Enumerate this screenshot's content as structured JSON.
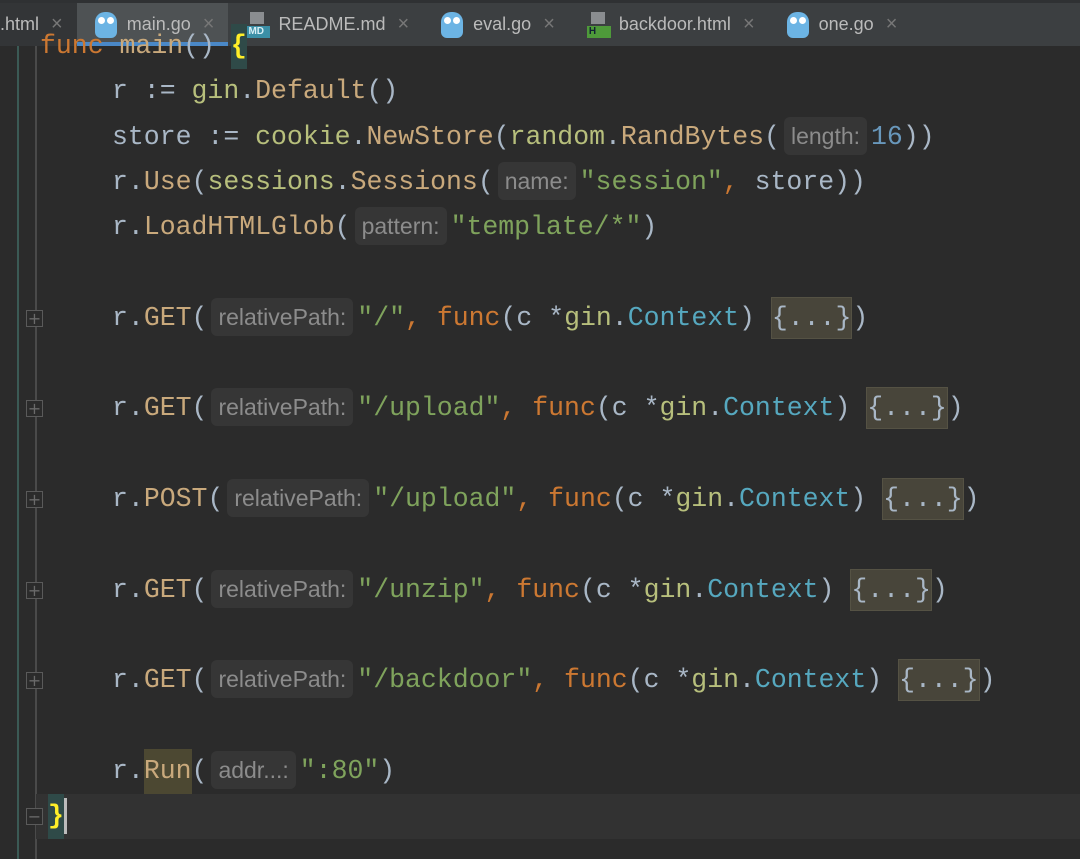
{
  "tabs": [
    {
      "label": ".html",
      "icon": "html-file-icon",
      "active": false
    },
    {
      "label": "main.go",
      "icon": "gopher-icon",
      "active": true
    },
    {
      "label": "README.md",
      "icon": "markdown-file-icon",
      "active": false
    },
    {
      "label": "eval.go",
      "icon": "gopher-icon",
      "active": false
    },
    {
      "label": "backdoor.html",
      "icon": "html-file-icon",
      "active": false
    },
    {
      "label": "one.go",
      "icon": "gopher-icon",
      "active": false
    }
  ],
  "close_glyph": "×",
  "colors": {
    "ident": "#a9b7c6",
    "pkg": "#b7bf7c",
    "func": "#c9a97c",
    "kw": "#cc7832",
    "str": "#7fa35c",
    "num": "#6897bb",
    "type": "#56a8bf",
    "bg": "#2b2b2b"
  },
  "code": [
    {
      "tokens": [
        [
          "func ",
          "kw"
        ],
        [
          "main",
          "func"
        ],
        [
          "() ",
          "ident"
        ],
        [
          "{",
          "brace"
        ]
      ],
      "fold": "open"
    },
    {
      "tokens": [
        [
          "r := ",
          "ident"
        ],
        [
          "gin",
          "pkg"
        ],
        [
          ".",
          "ident"
        ],
        [
          "Default",
          "func"
        ],
        [
          "()",
          "ident"
        ]
      ]
    },
    {
      "tokens": [
        [
          "store := ",
          "ident"
        ],
        [
          "cookie",
          "pkg"
        ],
        [
          ".",
          "ident"
        ],
        [
          "NewStore",
          "func"
        ],
        [
          "(",
          "ident"
        ],
        [
          "random",
          "pkg"
        ],
        [
          ".",
          "ident"
        ],
        [
          "RandBytes",
          "func"
        ],
        [
          "(",
          "ident"
        ],
        [
          "length:",
          "hint"
        ],
        [
          "16",
          "num"
        ],
        [
          "))",
          "ident"
        ]
      ]
    },
    {
      "tokens": [
        [
          "r.",
          "ident"
        ],
        [
          "Use",
          "func"
        ],
        [
          "(",
          "ident"
        ],
        [
          "sessions",
          "pkg"
        ],
        [
          ".",
          "ident"
        ],
        [
          "Sessions",
          "func"
        ],
        [
          "(",
          "ident"
        ],
        [
          "name:",
          "hint"
        ],
        [
          "\"session\"",
          "str"
        ],
        [
          ", ",
          "kw"
        ],
        [
          "store))",
          "ident"
        ]
      ]
    },
    {
      "tokens": [
        [
          "r.",
          "ident"
        ],
        [
          "LoadHTMLGlob",
          "func"
        ],
        [
          "(",
          "ident"
        ],
        [
          "pattern:",
          "hint"
        ],
        [
          "\"template/*\"",
          "str"
        ],
        [
          ")",
          "ident"
        ]
      ]
    },
    {
      "tokens": []
    },
    {
      "tokens": [
        [
          "r.",
          "ident"
        ],
        [
          "GET",
          "func"
        ],
        [
          "(",
          "ident"
        ],
        [
          "relativePath:",
          "hint"
        ],
        [
          "\"/\"",
          "str"
        ],
        [
          ", ",
          "kw"
        ],
        [
          "func",
          "kw"
        ],
        [
          "(c *",
          "ident"
        ],
        [
          "gin",
          "pkg"
        ],
        [
          ".",
          "ident"
        ],
        [
          "Context",
          "type"
        ],
        [
          ") ",
          "ident"
        ],
        [
          "{...}",
          "fold"
        ],
        [
          ")",
          "ident"
        ]
      ],
      "fold": "closed"
    },
    {
      "tokens": []
    },
    {
      "tokens": [
        [
          "r.",
          "ident"
        ],
        [
          "GET",
          "func"
        ],
        [
          "(",
          "ident"
        ],
        [
          "relativePath:",
          "hint"
        ],
        [
          "\"/upload\"",
          "str"
        ],
        [
          ", ",
          "kw"
        ],
        [
          "func",
          "kw"
        ],
        [
          "(c *",
          "ident"
        ],
        [
          "gin",
          "pkg"
        ],
        [
          ".",
          "ident"
        ],
        [
          "Context",
          "type"
        ],
        [
          ") ",
          "ident"
        ],
        [
          "{...}",
          "fold"
        ],
        [
          ")",
          "ident"
        ]
      ],
      "fold": "closed"
    },
    {
      "tokens": []
    },
    {
      "tokens": [
        [
          "r.",
          "ident"
        ],
        [
          "POST",
          "func"
        ],
        [
          "(",
          "ident"
        ],
        [
          "relativePath:",
          "hint"
        ],
        [
          "\"/upload\"",
          "str"
        ],
        [
          ", ",
          "kw"
        ],
        [
          "func",
          "kw"
        ],
        [
          "(c *",
          "ident"
        ],
        [
          "gin",
          "pkg"
        ],
        [
          ".",
          "ident"
        ],
        [
          "Context",
          "type"
        ],
        [
          ") ",
          "ident"
        ],
        [
          "{...}",
          "fold"
        ],
        [
          ")",
          "ident"
        ]
      ],
      "fold": "closed"
    },
    {
      "tokens": []
    },
    {
      "tokens": [
        [
          "r.",
          "ident"
        ],
        [
          "GET",
          "func"
        ],
        [
          "(",
          "ident"
        ],
        [
          "relativePath:",
          "hint"
        ],
        [
          "\"/unzip\"",
          "str"
        ],
        [
          ", ",
          "kw"
        ],
        [
          "func",
          "kw"
        ],
        [
          "(c *",
          "ident"
        ],
        [
          "gin",
          "pkg"
        ],
        [
          ".",
          "ident"
        ],
        [
          "Context",
          "type"
        ],
        [
          ") ",
          "ident"
        ],
        [
          "{...}",
          "fold"
        ],
        [
          ")",
          "ident"
        ]
      ],
      "fold": "closed"
    },
    {
      "tokens": []
    },
    {
      "tokens": [
        [
          "r.",
          "ident"
        ],
        [
          "GET",
          "func"
        ],
        [
          "(",
          "ident"
        ],
        [
          "relativePath:",
          "hint"
        ],
        [
          "\"/backdoor\"",
          "str"
        ],
        [
          ", ",
          "kw"
        ],
        [
          "func",
          "kw"
        ],
        [
          "(c *",
          "ident"
        ],
        [
          "gin",
          "pkg"
        ],
        [
          ".",
          "ident"
        ],
        [
          "Context",
          "type"
        ],
        [
          ") ",
          "ident"
        ],
        [
          "{...}",
          "fold"
        ],
        [
          ")",
          "ident"
        ]
      ],
      "fold": "closed"
    },
    {
      "tokens": []
    },
    {
      "tokens": [
        [
          "r.",
          "ident"
        ],
        [
          "Run",
          "hl"
        ],
        [
          "(",
          "ident"
        ],
        [
          "addr...:",
          "hint"
        ],
        [
          "\":80\"",
          "str"
        ],
        [
          ")",
          "ident"
        ]
      ]
    },
    {
      "tokens": [
        [
          "}",
          "brace"
        ]
      ],
      "fold": "end",
      "caret": true
    }
  ]
}
